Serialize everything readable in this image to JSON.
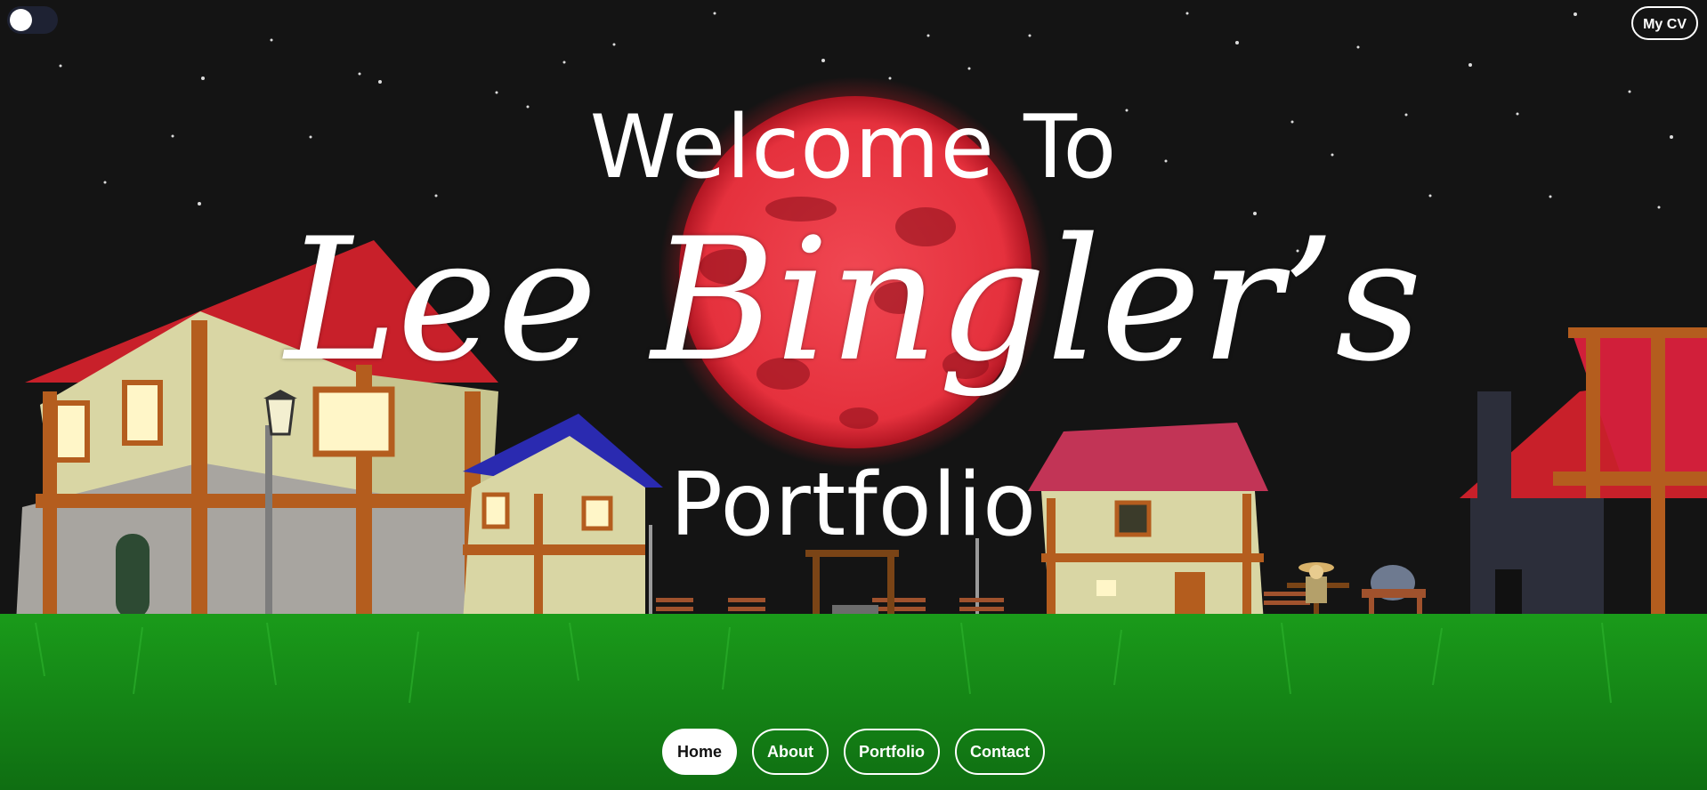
{
  "theme_toggle": {
    "state": "off"
  },
  "header": {
    "cv_label": "My CV"
  },
  "hero": {
    "line1": "Welcome To",
    "line2": "Lee Bingler’s",
    "line3": "Portfolio"
  },
  "nav": {
    "home_label": "Home",
    "about_label": "About",
    "portfolio_label": "Portfolio",
    "contact_label": "Contact",
    "active": "Home"
  },
  "colors": {
    "sky": "#141414",
    "moon": "#e8333e",
    "grass": "#1f8a1f",
    "roof_red": "#c8202a",
    "roof_blue": "#2a2ab0",
    "roof_pink": "#c23456",
    "wall": "#d9d6a4",
    "timber": "#b45d1e"
  }
}
